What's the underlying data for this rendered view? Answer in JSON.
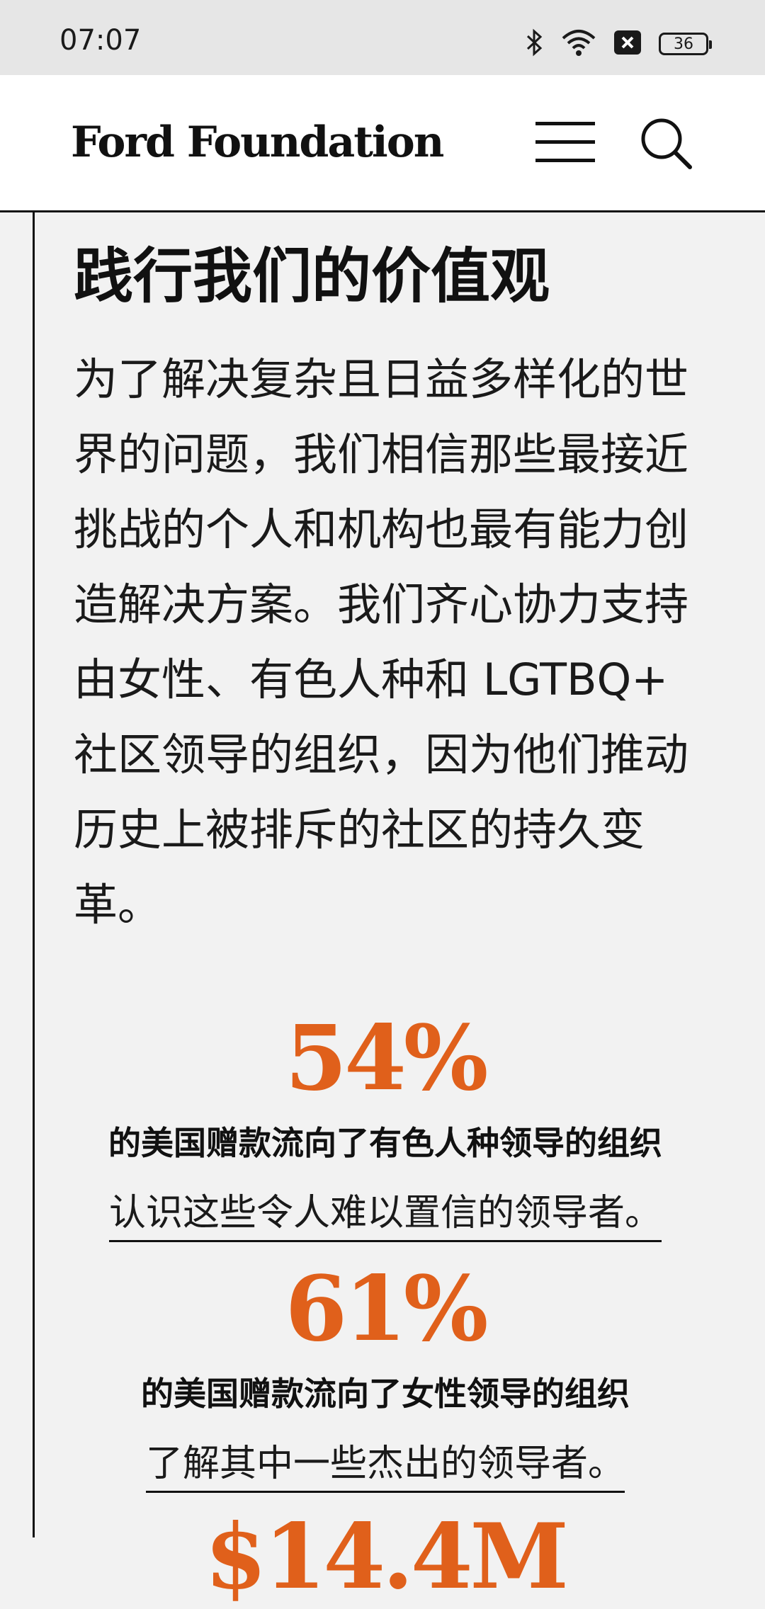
{
  "status_bar": {
    "time": "07:07",
    "battery": "36",
    "icons": [
      "bluetooth-icon",
      "wifi-icon",
      "close-box-icon",
      "battery-icon"
    ]
  },
  "header": {
    "brand": "Ford Foundation",
    "menu_icon": "menu-icon",
    "search_icon": "search-icon"
  },
  "section": {
    "title": "践行我们的价值观",
    "body": "为了解决复杂且日益多样化的世界的问题，我们相信那些最接近挑战的个人和机构也最有能力创造解决方案。我们齐心协力支持由女性、有色人种和 LGTBQ+ 社区领导的组织，因为他们推动历史上被排斥的社区的持久变革。"
  },
  "stats": [
    {
      "value": "54%",
      "caption": "的美国赠款流向了有色人种领导的组织",
      "link": "认识这些令人难以置信的领导者。"
    },
    {
      "value": "61%",
      "caption": "的美国赠款流向了女性领导的组织",
      "link": "了解其中一些杰出的领导者。"
    },
    {
      "value": "$14.4M"
    }
  ],
  "colors": {
    "accent": "#e0601b",
    "text": "#1a1a1a",
    "background": "#f2f2f2"
  }
}
